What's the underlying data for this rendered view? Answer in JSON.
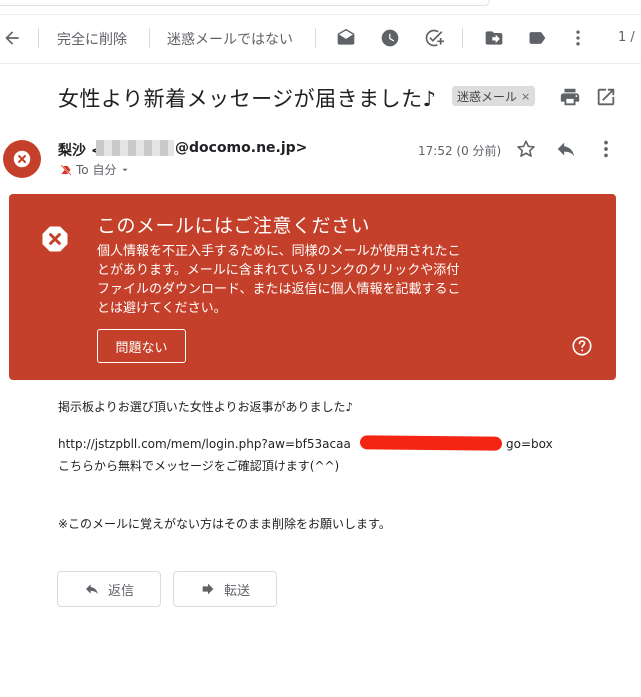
{
  "toolbar": {
    "delete_forever_label": "完全に削除",
    "not_spam_label": "迷惑メールではない",
    "page_indicator": "1 /"
  },
  "email": {
    "subject": "女性より新着メッセージが届きました♪",
    "label": "迷惑メール",
    "label_close": "×",
    "sender_name_prefix": "梨沙 <",
    "sender_domain": "@docomo.ne.jp>",
    "recipient": "To 自分",
    "time": "17:52 (0 分前)"
  },
  "banner": {
    "title": "このメールにはご注意ください",
    "body": "個人情報を不正入手するために、同様のメールが使用されたことがあります。メールに含まれているリンクのクリックや添付ファイルのダウンロード、または返信に個人情報を記載することは避けてください。",
    "button_label": "問題ない"
  },
  "body": {
    "line1": "掲示板よりお選び頂いた女性よりお返事がありました♪",
    "url_start": "http://jstzpbll.com/mem/login.php?aw=bf53acaa",
    "url_end": "go=box",
    "line3": "こちらから無料でメッセージをご確認頂けます(^^)",
    "line4": "※このメールに覚えがない方はそのまま削除をお願いします。"
  },
  "actions": {
    "reply_label": "返信",
    "forward_label": "転送"
  },
  "colors": {
    "warning": "#c5402a",
    "redaction": "#f42613"
  }
}
